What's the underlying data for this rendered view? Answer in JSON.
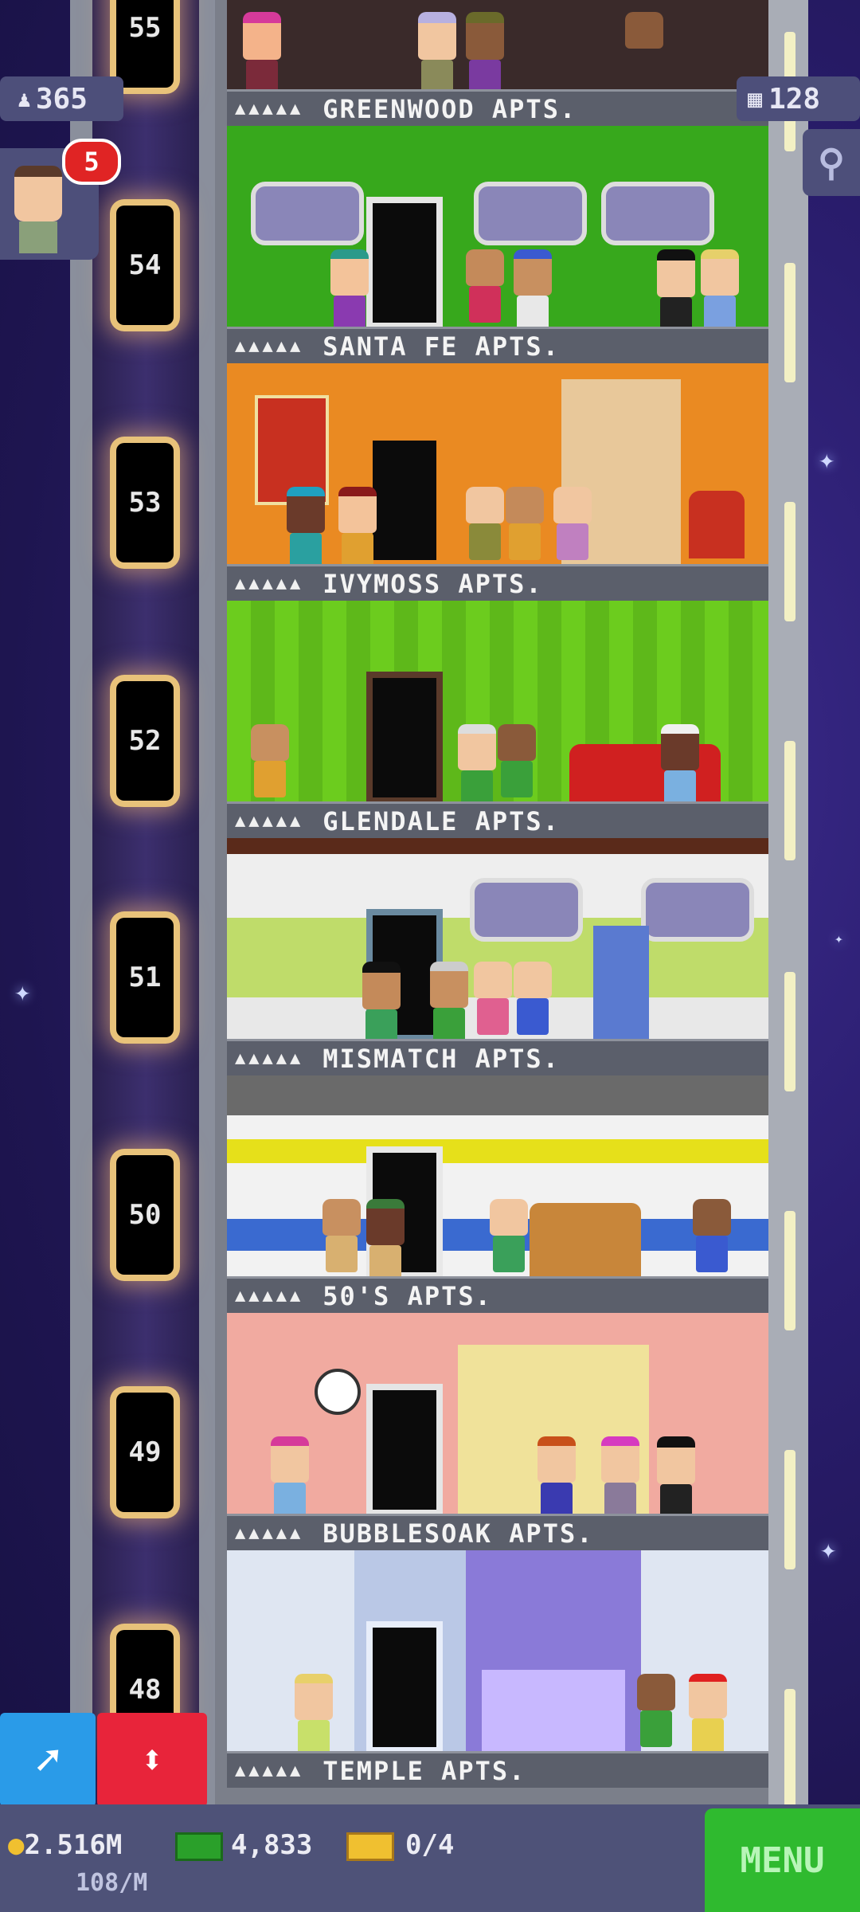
{
  "game": {
    "population": "365",
    "floors_count": "128",
    "notification_count": "5"
  },
  "elevator": {
    "floor_numbers": [
      "55",
      "54",
      "53",
      "52",
      "51",
      "50",
      "49",
      "48"
    ]
  },
  "floors": [
    {
      "name": "GREENWOOD APTS.",
      "dots": "▲▲▲▲▲",
      "wall": "#3a2a2a"
    },
    {
      "name": "SANTA FE APTS.",
      "dots": "▲▲▲▲▲",
      "wall": "#37a81c"
    },
    {
      "name": "IVYMOSS APTS.",
      "dots": "▲▲▲▲▲",
      "wall": "#ea8a22"
    },
    {
      "name": "GLENDALE APTS.",
      "dots": "▲▲▲▲▲",
      "wall": "#6ccc1e"
    },
    {
      "name": "MISMATCH APTS.",
      "dots": "▲▲▲▲▲",
      "wall": "#e8e8e8"
    },
    {
      "name": "50'S APTS.",
      "dots": "▲▲▲▲▲",
      "wall": "#f2f2f2"
    },
    {
      "name": "BUBBLESOAK APTS.",
      "dots": "▲▲▲▲▲",
      "wall": "#f1aaa0"
    },
    {
      "name": "TEMPLE APTS.",
      "dots": "▲▲▲▲▲",
      "wall": "#bac8e6"
    }
  ],
  "resources": {
    "coins": "2.516M",
    "coin_rate": "108/M",
    "bux": "4,833",
    "tickets": "0/4"
  },
  "buttons": {
    "menu": "MENU"
  },
  "icons": [
    "person-icon",
    "building-icon",
    "magnifier-icon",
    "up-arrow-icon",
    "elevator-icon",
    "coin-icon",
    "cash-icon",
    "ticket-icon"
  ]
}
